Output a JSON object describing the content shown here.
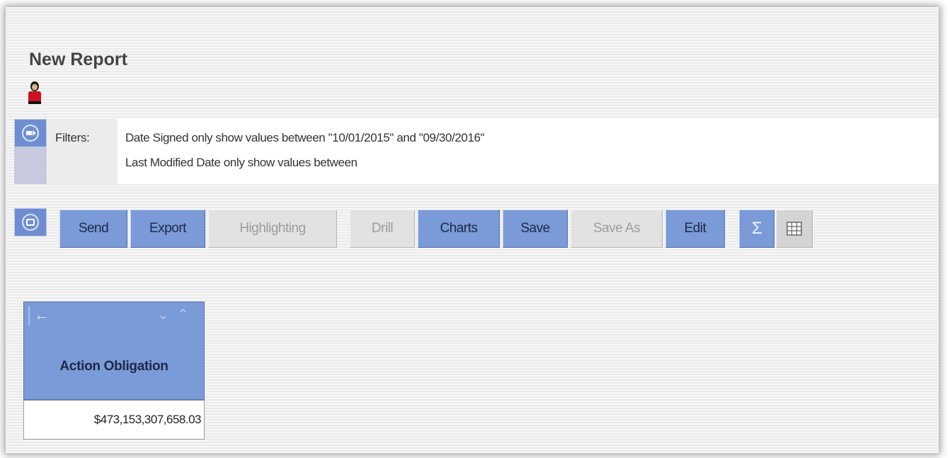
{
  "report": {
    "title": "New Report"
  },
  "filters": {
    "label": "Filters:",
    "lines": [
      "Date Signed only show values between \"10/01/2015\" and \"09/30/2016\"",
      "Last Modified Date only show values between"
    ]
  },
  "toolbar": {
    "send": "Send",
    "export": "Export",
    "highlighting": "Highlighting",
    "drill": "Drill",
    "charts": "Charts",
    "save": "Save",
    "save_as": "Save As",
    "edit": "Edit",
    "sigma": "Σ"
  },
  "table": {
    "column": "Action Obligation",
    "value": "$473,153,307,658.03"
  },
  "colors": {
    "button_active": "#7a9bd8",
    "button_disabled": "#e2e2e2",
    "user_icon": "#cc1122"
  }
}
